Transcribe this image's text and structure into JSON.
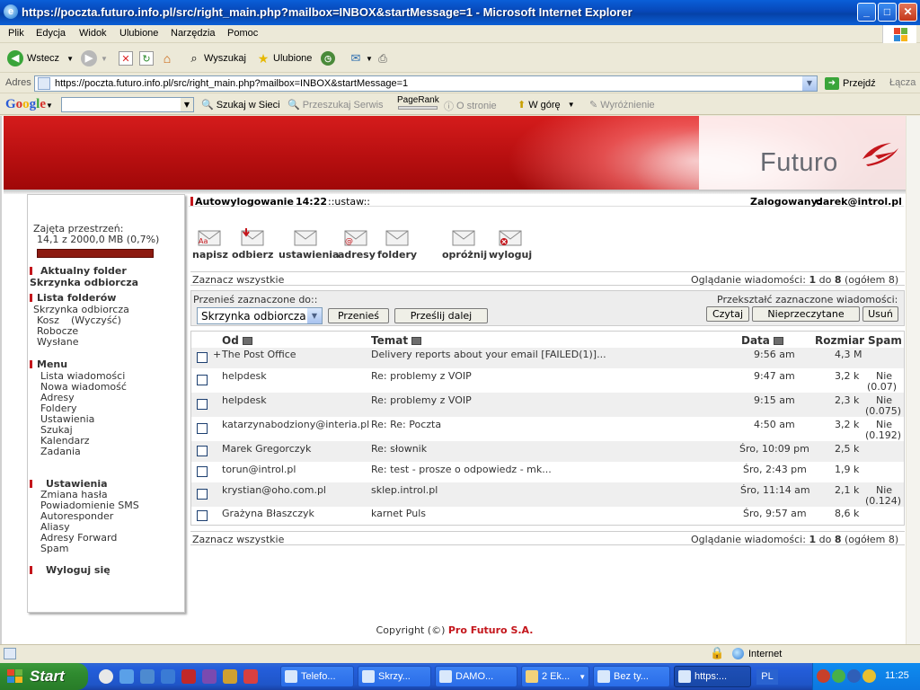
{
  "window": {
    "title": "https://poczta.futuro.info.pl/src/right_main.php?mailbox=INBOX&startMessage=1 - Microsoft Internet Explorer",
    "minimize": "_",
    "maximize": "□",
    "close": "✕"
  },
  "menu": [
    "Plik",
    "Edycja",
    "Widok",
    "Ulubione",
    "Narzędzia",
    "Pomoc"
  ],
  "toolbar": {
    "back": "Wstecz",
    "search": "Wyszukaj",
    "favorites": "Ulubione"
  },
  "address": {
    "label": "Adres",
    "url": "https://poczta.futuro.info.pl/src/right_main.php?mailbox=INBOX&startMessage=1",
    "go": "Przejdź",
    "links": "Łącza"
  },
  "googlebar": {
    "logo": "Google",
    "search_web": "Szukaj w Sieci",
    "search_site": "Przeszukaj Serwis",
    "pagerank": "PageRank",
    "about": "O stronie",
    "up": "W górę",
    "highlight": "Wyróżnienie"
  },
  "brand": {
    "logo": "Futuro",
    "red": "#c4161c"
  },
  "sidebar": {
    "quota_label": "Zajęta przestrzeń:",
    "quota_value": "14,1 z 2000,0 MB (0,7%)",
    "quota_fraction": 0.007,
    "current_folder_header": "Aktualny folder",
    "current_folder": "Skrzynka odbiorcza",
    "folders_header": "Lista folderów",
    "folders": [
      "Skrzynka odbiorcza",
      "Kosz",
      "(Wyczyść)",
      "Robocze",
      "Wysłane"
    ],
    "menu_header": "Menu",
    "menu_items": [
      "Lista wiadomości",
      "Nowa wiadomość",
      "Adresy",
      "Foldery",
      "Ustawienia",
      "Szukaj",
      "Kalendarz",
      "Zadania"
    ],
    "settings_header": "Ustawienia",
    "settings_items": [
      "Zmiana hasła",
      "Powiadomienie SMS",
      "Autoresponder",
      "Aliasy",
      "Adresy Forward",
      "Spam"
    ],
    "logout": "Wyloguj się"
  },
  "info": {
    "autologout": "Autowylogowanie",
    "time": "14:22",
    "settings_link": "::ustaw::",
    "logged_label": "Zalogowany:",
    "user": "darek@introl.pl"
  },
  "actions": [
    "napisz",
    "odbierz",
    "ustawienia",
    "adresy",
    "foldery",
    "opróżnij",
    "wyloguj"
  ],
  "selection": {
    "select_all": "Zaznacz wszystkie",
    "viewing_prefix": "Oglądanie wiadomości:",
    "from": "1",
    "to_word": "do",
    "to": "8",
    "total_text": "(ogółem 8)"
  },
  "move": {
    "label": "Przenieś zaznaczone do::",
    "selected_folder": "Skrzynka odbiorcza",
    "move_button": "Przenieś",
    "forward_button": "Prześlij dalej",
    "transform_label": "Przekształć zaznaczone wiadomości:",
    "read_button": "Czytaj",
    "unread_button": "Nieprzeczytane",
    "delete_button": "Usuń"
  },
  "table": {
    "headers": {
      "from": "Od",
      "subject": "Temat",
      "date": "Data",
      "size": "Rozmiar",
      "spam": "Spam"
    },
    "rows": [
      {
        "prefix": "+",
        "from": "The Post Office",
        "subject": "Delivery reports about your email [FAILED(1)]...",
        "date": "9:56 am",
        "size": "4,3 M",
        "spam": "",
        "score": ""
      },
      {
        "prefix": "",
        "from": "helpdesk",
        "subject": "Re: problemy z VOIP",
        "date": "9:47 am",
        "size": "3,2 k",
        "spam": "Nie",
        "score": "(0.07)"
      },
      {
        "prefix": "",
        "from": "helpdesk",
        "subject": "Re: problemy z VOIP",
        "date": "9:15 am",
        "size": "2,3 k",
        "spam": "Nie",
        "score": "(0.075)"
      },
      {
        "prefix": "",
        "from": "katarzynabodziony@interia.pl",
        "subject": "Re: Re: Poczta",
        "date": "4:50 am",
        "size": "3,2 k",
        "spam": "Nie",
        "score": "(0.192)"
      },
      {
        "prefix": "",
        "from": "Marek Gregorczyk",
        "subject": "Re: słownik",
        "date": "Śro, 10:09 pm",
        "size": "2,5 k",
        "spam": "",
        "score": ""
      },
      {
        "prefix": "",
        "from": "torun@introl.pl",
        "subject": "Re: test - prosze o odpowiedz - mk...",
        "date": "Śro, 2:43 pm",
        "size": "1,9 k",
        "spam": "",
        "score": ""
      },
      {
        "prefix": "",
        "from": "krystian@oho.com.pl",
        "subject": "sklep.introl.pl",
        "date": "Śro, 11:14 am",
        "size": "2,1 k",
        "spam": "Nie",
        "score": "(0.124)"
      },
      {
        "prefix": "",
        "from": "Grażyna Błaszczyk",
        "subject": "karnet Puls",
        "date": "Śro, 9:57 am",
        "size": "8,6 k",
        "spam": "",
        "score": ""
      }
    ]
  },
  "footer": {
    "copyright": "Copyright (©)",
    "company": "Pro Futuro S.A."
  },
  "status": {
    "zone": "Internet"
  },
  "taskbar": {
    "start": "Start",
    "tasks": [
      "Telefo...",
      "Skrzy...",
      "DAMO...",
      "2 Ek...",
      "Bez ty...",
      "https:..."
    ],
    "lang": "PL",
    "clock": "11:25"
  }
}
